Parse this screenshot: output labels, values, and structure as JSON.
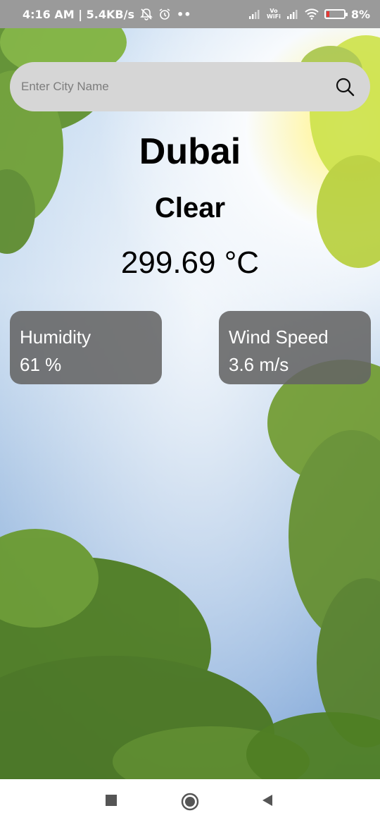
{
  "status_bar": {
    "time_net": "4:16 AM | 5.4KB/s",
    "dots": "••",
    "vowifi_top": "Vo",
    "vowifi_bottom": "WiFi",
    "battery_text": "8%",
    "icons": [
      "mute-icon",
      "alarm-icon",
      "signal-icon",
      "vowifi-icon",
      "wifi-icon",
      "battery-icon"
    ]
  },
  "search": {
    "placeholder": "Enter City Name",
    "icon": "search-icon"
  },
  "weather": {
    "city": "Dubai",
    "condition": "Clear",
    "temperature": "299.69 °C"
  },
  "cards": {
    "humidity": {
      "label": "Humidity",
      "value": "61 %"
    },
    "wind": {
      "label": "Wind Speed",
      "value": "3.6 m/s"
    }
  },
  "nav": {
    "icons": [
      "recents-square-icon",
      "home-circle-icon",
      "back-triangle-icon"
    ]
  },
  "colors": {
    "search_bg": "#d6d6d6",
    "card_bg": "#646464",
    "status_bar_bg": "#9a9a9a",
    "battery_low": "#e53935"
  }
}
